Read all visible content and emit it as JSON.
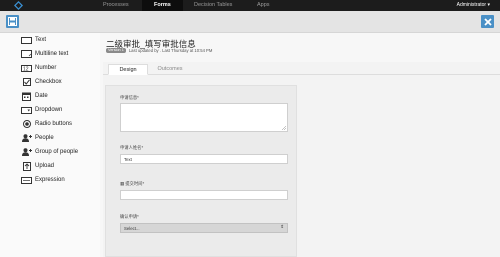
{
  "nav": {
    "items": [
      {
        "label": "Processes"
      },
      {
        "label": "Forms"
      },
      {
        "label": "Decision Tables"
      },
      {
        "label": "Apps"
      }
    ],
    "user": "Administrator ▾"
  },
  "toolbar": {
    "save_icon": "save-icon",
    "close_icon": "close-icon",
    "accent": "#4a90c6"
  },
  "palette": {
    "items": [
      {
        "label": "Text",
        "icon": "text-icon"
      },
      {
        "label": "Multiline text",
        "icon": "multiline-text-icon"
      },
      {
        "label": "Number",
        "icon": "number-icon"
      },
      {
        "label": "Checkbox",
        "icon": "checkbox-icon"
      },
      {
        "label": "Date",
        "icon": "date-icon"
      },
      {
        "label": "Dropdown",
        "icon": "dropdown-icon"
      },
      {
        "label": "Radio buttons",
        "icon": "radio-icon"
      },
      {
        "label": "People",
        "icon": "people-icon"
      },
      {
        "label": "Group of people",
        "icon": "group-icon"
      },
      {
        "label": "Upload",
        "icon": "upload-icon"
      },
      {
        "label": "Expression",
        "icon": "expression-icon"
      }
    ]
  },
  "form": {
    "title": "二级审批_填写审批信息",
    "version": "Version 1",
    "updated": "Last updated by . Last Thursday at 10:54 PM",
    "tabs": [
      {
        "label": "Design"
      },
      {
        "label": "Outcomes"
      }
    ],
    "fields": [
      {
        "label": "申请信息*",
        "type": "textarea",
        "value": ""
      },
      {
        "label": "申请人姓名*",
        "type": "text",
        "value": "Text"
      },
      {
        "label": "▦ 提交时间*",
        "type": "date",
        "value": ""
      },
      {
        "label": "确认申请*",
        "type": "select",
        "value": "Select..."
      }
    ]
  }
}
